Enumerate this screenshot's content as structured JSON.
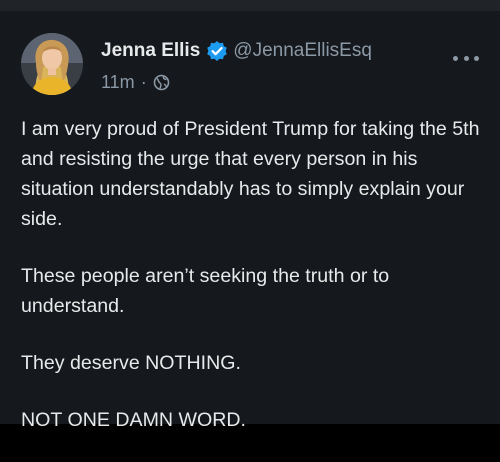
{
  "author": {
    "display_name": "Jenna Ellis",
    "handle": "@JennaEllisEsq",
    "verified": true
  },
  "meta": {
    "timestamp": "11m",
    "separator": "·",
    "audience_icon": "globe-icon"
  },
  "tweet": {
    "paragraphs": [
      "I am very proud of President Trump for taking the 5th and resisting the urge that every person in his situation understandably has to simply explain your side.",
      "These people aren’t seeking the truth or to understand.",
      "They deserve NOTHING.",
      "NOT ONE DAMN WORD."
    ]
  },
  "icons": {
    "more": "more-options-icon",
    "verified": "verified-badge-icon"
  },
  "colors": {
    "background": "#15181c",
    "text": "#e7e9ea",
    "secondary_text": "#8b98a5",
    "verified_blue": "#1d9bf0"
  }
}
